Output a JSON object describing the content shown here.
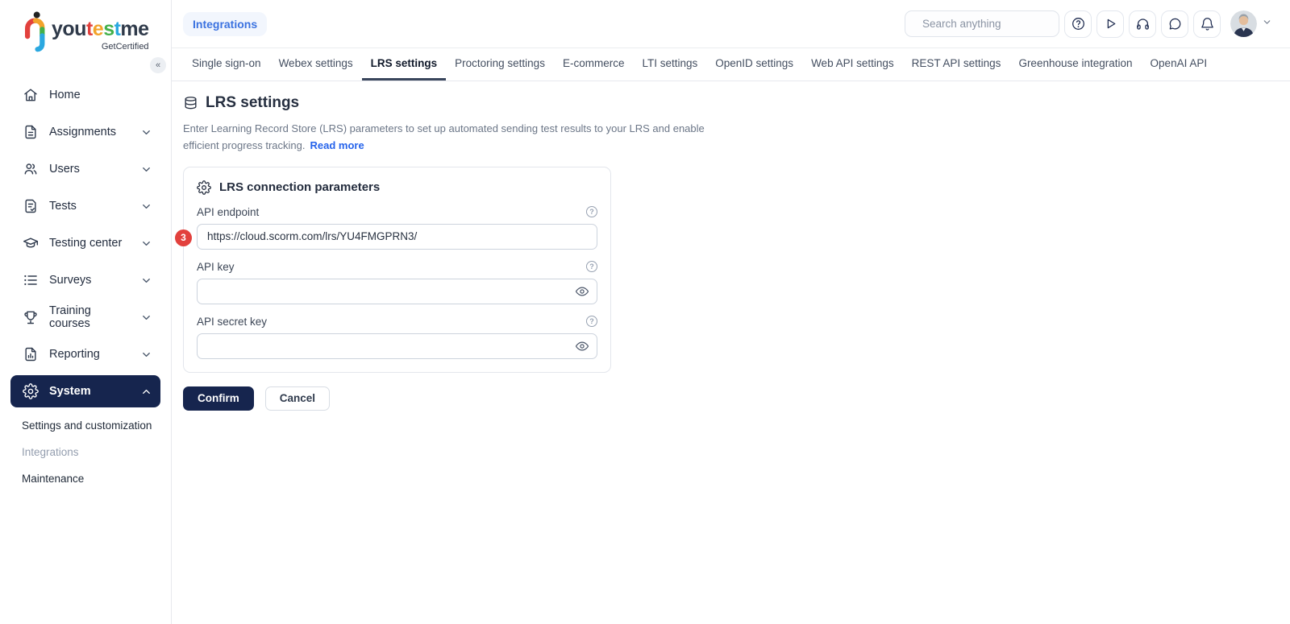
{
  "brand": {
    "word": {
      "s0": "you",
      "s1": "t",
      "s2": "e",
      "s3": "s",
      "s4": "t",
      "s5": "me"
    },
    "tagline": "GetCertified",
    "collapse_glyph": "«"
  },
  "sidebar": {
    "items": [
      {
        "label": "Home",
        "icon": "home-icon",
        "expandable": false
      },
      {
        "label": "Assignments",
        "icon": "assignments-icon",
        "expandable": true
      },
      {
        "label": "Users",
        "icon": "users-icon",
        "expandable": true
      },
      {
        "label": "Tests",
        "icon": "tests-icon",
        "expandable": true
      },
      {
        "label": "Testing center",
        "icon": "testing-center-icon",
        "expandable": true
      },
      {
        "label": "Surveys",
        "icon": "surveys-icon",
        "expandable": true
      },
      {
        "label": "Training courses",
        "icon": "training-courses-icon",
        "expandable": true
      },
      {
        "label": "Reporting",
        "icon": "reporting-icon",
        "expandable": true
      },
      {
        "label": "System",
        "icon": "gear-icon",
        "expandable": true,
        "active": true,
        "expanded": true
      }
    ],
    "subitems": [
      {
        "label": "Settings and customization"
      },
      {
        "label": "Integrations",
        "current": true
      },
      {
        "label": "Maintenance"
      }
    ]
  },
  "header": {
    "breadcrumb": "Integrations",
    "search": {
      "placeholder": "Search anything",
      "icon": "search-icon"
    },
    "icon_buttons": [
      "help-icon",
      "play-icon",
      "headset-icon",
      "chat-icon",
      "bell-icon"
    ]
  },
  "tabs": {
    "items": [
      "Single sign-on",
      "Webex settings",
      "LRS settings",
      "Proctoring settings",
      "E-commerce",
      "LTI settings",
      "OpenID settings",
      "Web API settings",
      "REST API settings",
      "Greenhouse integration",
      "OpenAI API"
    ],
    "active": "LRS settings"
  },
  "page": {
    "title": "LRS settings",
    "title_icon": "database-icon",
    "description_line1": "Enter Learning Record Store (LRS) parameters to set up automated sending test results to your LRS and enable",
    "description_line2": "efficient progress tracking.",
    "read_more": "Read more"
  },
  "form": {
    "card_title": "LRS connection parameters",
    "card_icon": "gear-icon",
    "fields": [
      {
        "label": "API endpoint",
        "value": "https://cloud.scorm.com/lrs/YU4FMGPRN3/",
        "has_eye": false,
        "step_badge": "3"
      },
      {
        "label": "API key",
        "value": "",
        "has_eye": true
      },
      {
        "label": "API secret key",
        "value": "",
        "has_eye": true
      }
    ],
    "confirm_label": "Confirm",
    "cancel_label": "Cancel"
  },
  "colors": {
    "accent_navy": "#16254e",
    "badge_red": "#e2413d",
    "link_blue": "#2563eb",
    "breadcrumb_blue": "#3b72e0",
    "logo_red": "#e2413d",
    "logo_orange": "#f2a32b",
    "logo_green": "#43b04a",
    "logo_blue": "#2ba8e0"
  }
}
